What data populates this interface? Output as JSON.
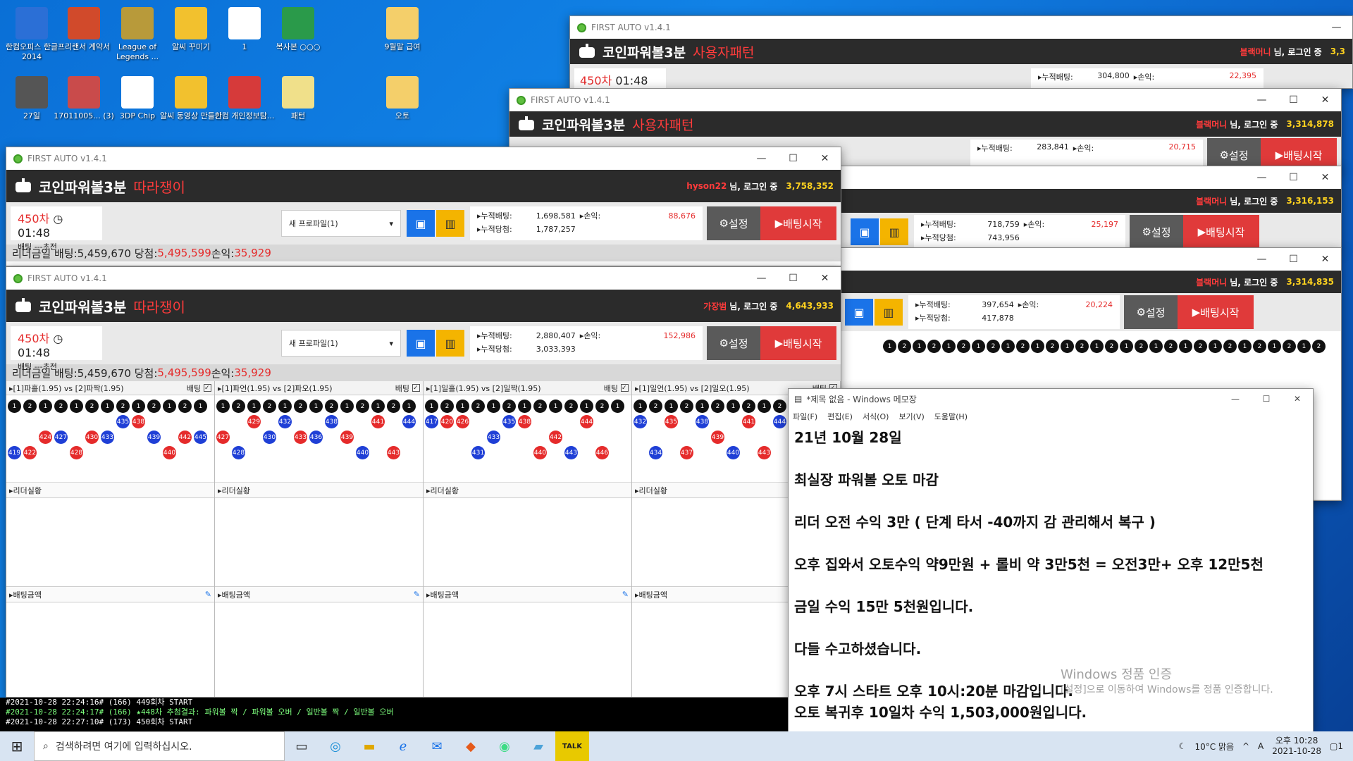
{
  "desktop": {
    "icons": [
      {
        "label": "한컴오피스 한글 2014",
        "icon": "hancom-icon",
        "color": "#2b6fd6"
      },
      {
        "label": "프리랜서 계약서",
        "icon": "doc-icon",
        "color": "#d14a2b"
      },
      {
        "label": "League of Legends ...",
        "icon": "game-icon",
        "color": "#b89a3a"
      },
      {
        "label": "알씨 꾸미기",
        "icon": "alsee-icon",
        "color": "#f2c12e"
      },
      {
        "label": "1",
        "icon": "file-icon",
        "color": "#ffffff"
      },
      {
        "label": "복사본 ○○○",
        "icon": "sheet-icon",
        "color": "#2a9a4a"
      },
      {
        "label": "9월말 급여",
        "icon": "folder-icon",
        "color": "#f4cf6a"
      },
      {
        "label": "27일",
        "icon": "screen-icon",
        "color": "#555555"
      },
      {
        "label": "17011005... (3)",
        "icon": "doc-icon",
        "color": "#c94b4b"
      },
      {
        "label": "3DP Chip",
        "icon": "file-icon",
        "color": "#ffffff"
      },
      {
        "label": "알씨 동영상 만들기",
        "icon": "movie-icon",
        "color": "#f2c12e"
      },
      {
        "label": "한컴 개인정보탐...",
        "icon": "search-icon",
        "color": "#d63a3a"
      },
      {
        "label": "패턴",
        "icon": "notes-icon",
        "color": "#f0e08a"
      },
      {
        "label": "오토",
        "icon": "folder-icon",
        "color": "#f4cf6a"
      }
    ]
  },
  "app": {
    "title": "FIRST AUTO v1.4.1",
    "game": "코인파워볼3분",
    "mode_follow": "따라쟁이",
    "mode_user": "사용자패턴",
    "login_suffix": "님, 로그인 중",
    "round": "450차",
    "time": "01:48",
    "bet_status": "배팅 ---초전",
    "profile": "새 프로파일(1)",
    "settings_label": "설정",
    "start_label": "배팅시작",
    "cum_bet_label": "▸누적배팅:",
    "cum_win_label": "▸누적당첨:",
    "profit_label": "▸손익:",
    "leader_summary_prefix": "리더금일 배팅:5,459,670 당첨:",
    "leader_summary_win": "5,495,599",
    "leader_summary_profit_label": " 손익:",
    "leader_summary_profit": "35,929"
  },
  "windows": [
    {
      "user": "hyson22",
      "balance": "3,758,352",
      "cum_bet": "1,698,581",
      "cum_win": "1,787,257",
      "profit": "88,676"
    },
    {
      "user": "가장범",
      "balance": "4,643,933",
      "cum_bet": "2,880,407",
      "cum_win": "3,033,393",
      "profit": "152,986"
    },
    {
      "user": "블랙머니",
      "balance": "3,3",
      "cum_bet": "304,800",
      "profit": "22,395"
    },
    {
      "user": "블랙머니",
      "balance": "3,314,878",
      "cum_bet": "283,841",
      "profit": "20,715"
    },
    {
      "user": "블랙머니",
      "balance": "3,316,153",
      "cum_bet": "718,759",
      "cum_win": "743,956",
      "profit": "25,197"
    },
    {
      "user": "블랙머니",
      "balance": "3,314,835",
      "cum_bet": "397,654",
      "cum_win": "417,878",
      "profit": "20,224"
    }
  ],
  "panels": [
    {
      "title": "▸[1]파홀(1.95) vs [2]파짝(1.95)",
      "bet": "배팅"
    },
    {
      "title": "▸[1]파언(1.95) vs [2]파오(1.95)",
      "bet": "배팅"
    },
    {
      "title": "▸[1]일홀(1.95) vs [2]일짝(1.95)",
      "bet": "배팅"
    },
    {
      "title": "▸[1]일언(1.95) vs [2]일오(1.95)",
      "bet": "배팅"
    }
  ],
  "panel_sections": {
    "leader": "▸리더실황",
    "amount": "▸배팅금액"
  },
  "notepad": {
    "title": "*제목 없음 - Windows 메모장",
    "menu": [
      "파일(F)",
      "편집(E)",
      "서식(O)",
      "보기(V)",
      "도움말(H)"
    ],
    "lines": [
      "21년 10월 28일",
      "",
      "최실장 파워볼 오토 마감",
      "",
      "리더 오전 수익 3만 ( 단계 타서 -40까지 감 관리해서 복구 )",
      "",
      "오후 집와서 오토수익 약9만원 + 롤비 약 3만5천 = 오전3만+ 오후 12만5천",
      "",
      "금일 수익 15만 5천원입니다.",
      "",
      "다들 수고하셨습니다.",
      "",
      "오후 7시 스타트 오후 10시:20분 마감입니다.",
      "오토 복귀후 10일차 수익 1,503,000원입니다."
    ]
  },
  "watermark": {
    "title": "Windows 정품 인증",
    "sub": "[설정]으로 이동하여 Windows를 정품 인증합니다."
  },
  "log": [
    "#2021-10-28 22:24:16# (166) 449회차 START",
    "#2021-10-28 22:24:17# (166) ★448차 추첨결과: 파워볼 짝 / 파워볼 오버 / 일반볼 짝 / 일반볼 오버",
    "#2021-10-28 22:27:10# (173) 450회차 START"
  ],
  "taskbar": {
    "search_placeholder": "검색하려면 여기에 입력하십시오.",
    "weather": "10°C 맑음",
    "ime": "A",
    "time": "오후 10:28",
    "date": "2021-10-28",
    "notif": "1"
  }
}
